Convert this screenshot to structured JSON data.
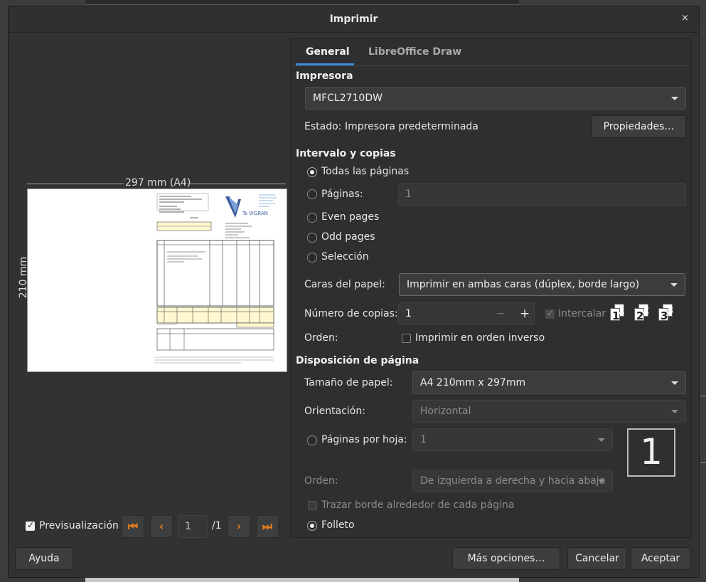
{
  "dialog": {
    "title": "Imprimir",
    "close_glyph": "×"
  },
  "preview": {
    "width_label": "297 mm (A4)",
    "height_label": "210 mm",
    "checkbox_label": "Previsualización",
    "page_current": "1",
    "page_total": "/1"
  },
  "tabs": [
    {
      "label": "General"
    },
    {
      "label": "LibreOffice Draw"
    }
  ],
  "printer": {
    "section": "Impresora",
    "selected": "MFCL2710DW",
    "status_label": "Estado:",
    "status_value": "Impresora predeterminada",
    "properties_button": "Propiedades…"
  },
  "range": {
    "section": "Intervalo y copias",
    "options": [
      {
        "label": "Todas las páginas",
        "checked": true
      },
      {
        "label": "Páginas:",
        "checked": false
      },
      {
        "label": "Even pages",
        "checked": false
      },
      {
        "label": "Odd pages",
        "checked": false
      },
      {
        "label": "Selección",
        "checked": false
      }
    ],
    "pages_value": "1",
    "paper_sides_label": "Caras del papel:",
    "paper_sides_value": "Imprimir en ambas caras (dúplex, borde largo)",
    "copies_label": "Número de copias:",
    "copies_value": "1",
    "minus": "−",
    "plus": "+",
    "collate_label": "Intercalar",
    "order_label": "Orden:",
    "reverse_label": "Imprimir en orden inverso"
  },
  "layout": {
    "section": "Disposición de página",
    "paper_size_label": "Tamaño de papel:",
    "paper_size_value": "A4 210mm x 297mm",
    "orientation_label": "Orientación:",
    "orientation_value": "Horizontal",
    "pages_per_sheet_label": "Páginas por hoja:",
    "pages_per_sheet_value": "1",
    "pages_preview_number": "1",
    "order_label": "Orden:",
    "order_value": "De izquierda a derecha y hacia abajo",
    "border_label": "Trazar borde alrededor de cada página",
    "brochure_label": "Folleto"
  },
  "buttons": {
    "help": "Ayuda",
    "more": "Más opciones…",
    "cancel": "Cancelar",
    "accept": "Aceptar"
  },
  "invoice": {
    "logo_text": "Ts VIGRAN"
  },
  "colors": {
    "nav_accent": "#e07a1f",
    "tab_underline": "#3b8bd8"
  }
}
